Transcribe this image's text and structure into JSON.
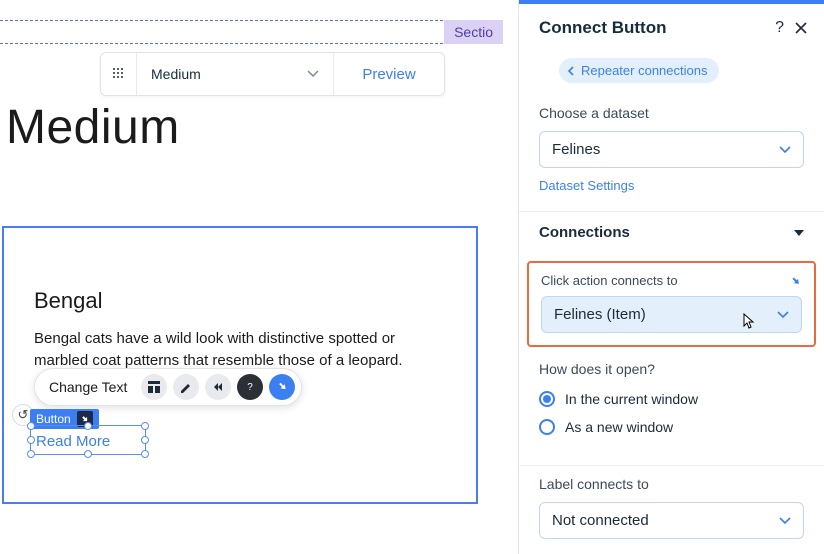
{
  "section_tag": "Sectio",
  "floating_bar": {
    "size_label": "Medium",
    "preview_label": "Preview"
  },
  "page_title": "Medium",
  "card": {
    "title": "Bengal",
    "text": "Bengal cats have a wild look with distinctive spotted or marbled coat patterns that resemble those of a leopard.",
    "read_more": "Read More"
  },
  "button_badge": "Button",
  "toolbar": {
    "change_text": "Change Text"
  },
  "panel": {
    "title": "Connect Button",
    "breadcrumb": "Repeater connections",
    "choose_dataset_label": "Choose a dataset",
    "dataset_value": "Felines",
    "dataset_settings": "Dataset Settings",
    "connections_header": "Connections",
    "click_action_label": "Click action connects to",
    "click_action_value": "Felines (Item)",
    "open_label": "How does it open?",
    "open_option_current": "In the current window",
    "open_option_new": "As a new window",
    "label_connects_label": "Label connects to",
    "label_connects_value": "Not connected"
  }
}
